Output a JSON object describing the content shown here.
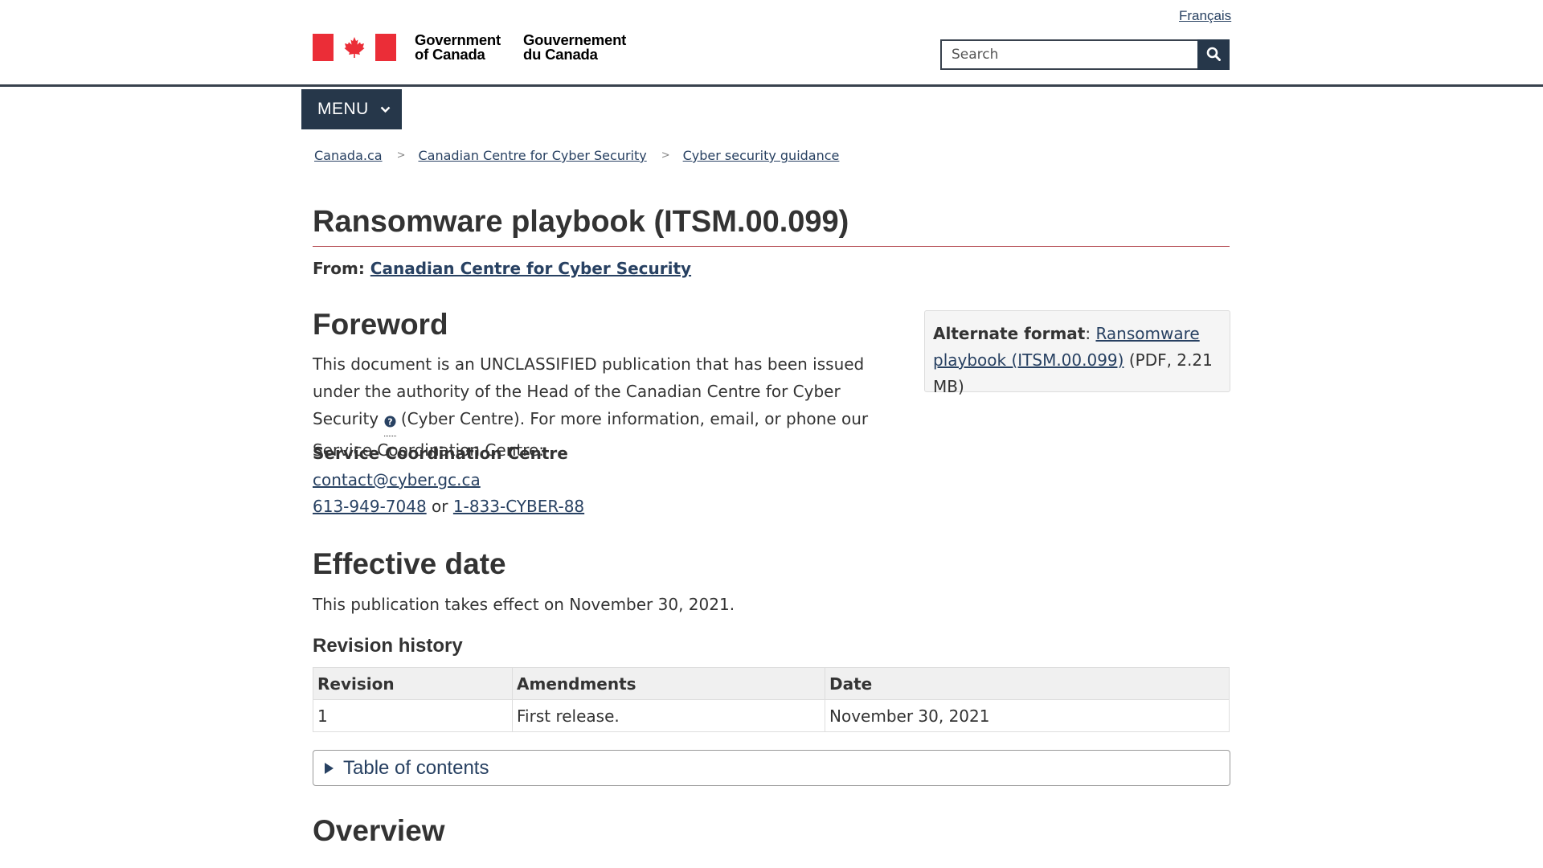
{
  "header": {
    "language_link": "Français",
    "wordmark_en_line1": "Government",
    "wordmark_en_line2": "of Canada",
    "wordmark_fr_line1": "Gouvernement",
    "wordmark_fr_line2": "du Canada",
    "search_placeholder": "Search",
    "menu_label": "MENU"
  },
  "breadcrumb": [
    "Canada.ca",
    "Canadian Centre for Cyber Security",
    "Cyber security guidance"
  ],
  "page": {
    "title": "Ransomware playbook (ITSM.00.099)",
    "from_label": "From:",
    "from_link": "Canadian Centre for Cyber Security"
  },
  "alternate_format": {
    "label": "Alternate format",
    "colon": ":",
    "link": "Ransomware playbook (ITSM.00.099)",
    "meta": "(PDF, 2.21 MB)"
  },
  "foreword": {
    "heading": "Foreword",
    "text_1": "This document is an UNCLASSIFIED publication that has been issued under the authority of the Head of the Canadian Centre for Cyber Security",
    "text_2": "(Cyber Centre). For more information, email, or phone our Service Coordination Centre:",
    "contact_label": "Service Coordination Centre",
    "email": "contact@cyber.gc.ca",
    "phone_1": "613-949-7048",
    "or": "or",
    "phone_2": "1-833-CYBER-88"
  },
  "effective": {
    "heading": "Effective date",
    "text": "This publication takes effect on November 30, 2021."
  },
  "revision": {
    "heading": "Revision history",
    "columns": [
      "Revision",
      "Amendments",
      "Date"
    ],
    "rows": [
      [
        "1",
        "First release.",
        "November 30, 2021"
      ]
    ]
  },
  "toc_label": "Table of contents",
  "overview": {
    "heading": "Overview"
  },
  "colors": {
    "nav_dark": "#26374a",
    "link": "#284162",
    "flag_red": "#eb2d37",
    "title_rule": "#af3c43"
  },
  "icons": [
    "canada-flag-icon",
    "search-icon",
    "chevron-down-icon",
    "question-icon",
    "disclosure-triangle-icon"
  ]
}
